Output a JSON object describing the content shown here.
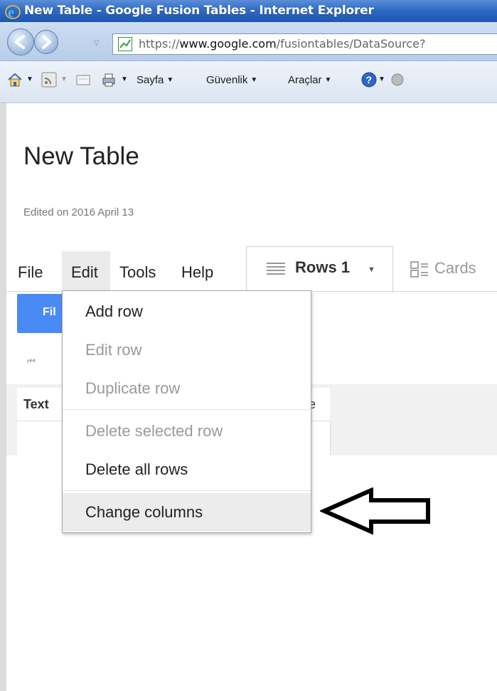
{
  "window": {
    "title": "New Table - Google Fusion Tables - Internet Explorer",
    "url_scheme": "https://",
    "url_domain": "www.google.com",
    "url_path": "/fusiontables/DataSource?"
  },
  "command_bar": {
    "page_label": "Sayfa",
    "security_label": "Güvenlik",
    "tools_label": "Araçlar"
  },
  "page": {
    "title": "New Table",
    "edited": "Edited on 2016 April 13"
  },
  "menubar": {
    "file": "File",
    "edit": "Edit",
    "tools": "Tools",
    "help": "Help"
  },
  "tabs": {
    "rows": "Rows 1",
    "cards": "Cards"
  },
  "filter_label": "Fil",
  "table": {
    "col1": "Text",
    "col2": "e"
  },
  "edit_menu": {
    "items": [
      {
        "label": "Add row",
        "enabled": true
      },
      {
        "label": "Edit row",
        "enabled": false
      },
      {
        "label": "Duplicate row",
        "enabled": false
      },
      {
        "label": "Delete selected row",
        "enabled": false
      },
      {
        "label": "Delete all rows",
        "enabled": true
      },
      {
        "label": "Change columns",
        "enabled": true,
        "highlighted": true
      }
    ]
  },
  "colors": {
    "ie_title": "#2f6bc5",
    "filter_button": "#4a8af4",
    "menu_highlight": "#ececec",
    "disabled_text": "#9a9a9a"
  }
}
